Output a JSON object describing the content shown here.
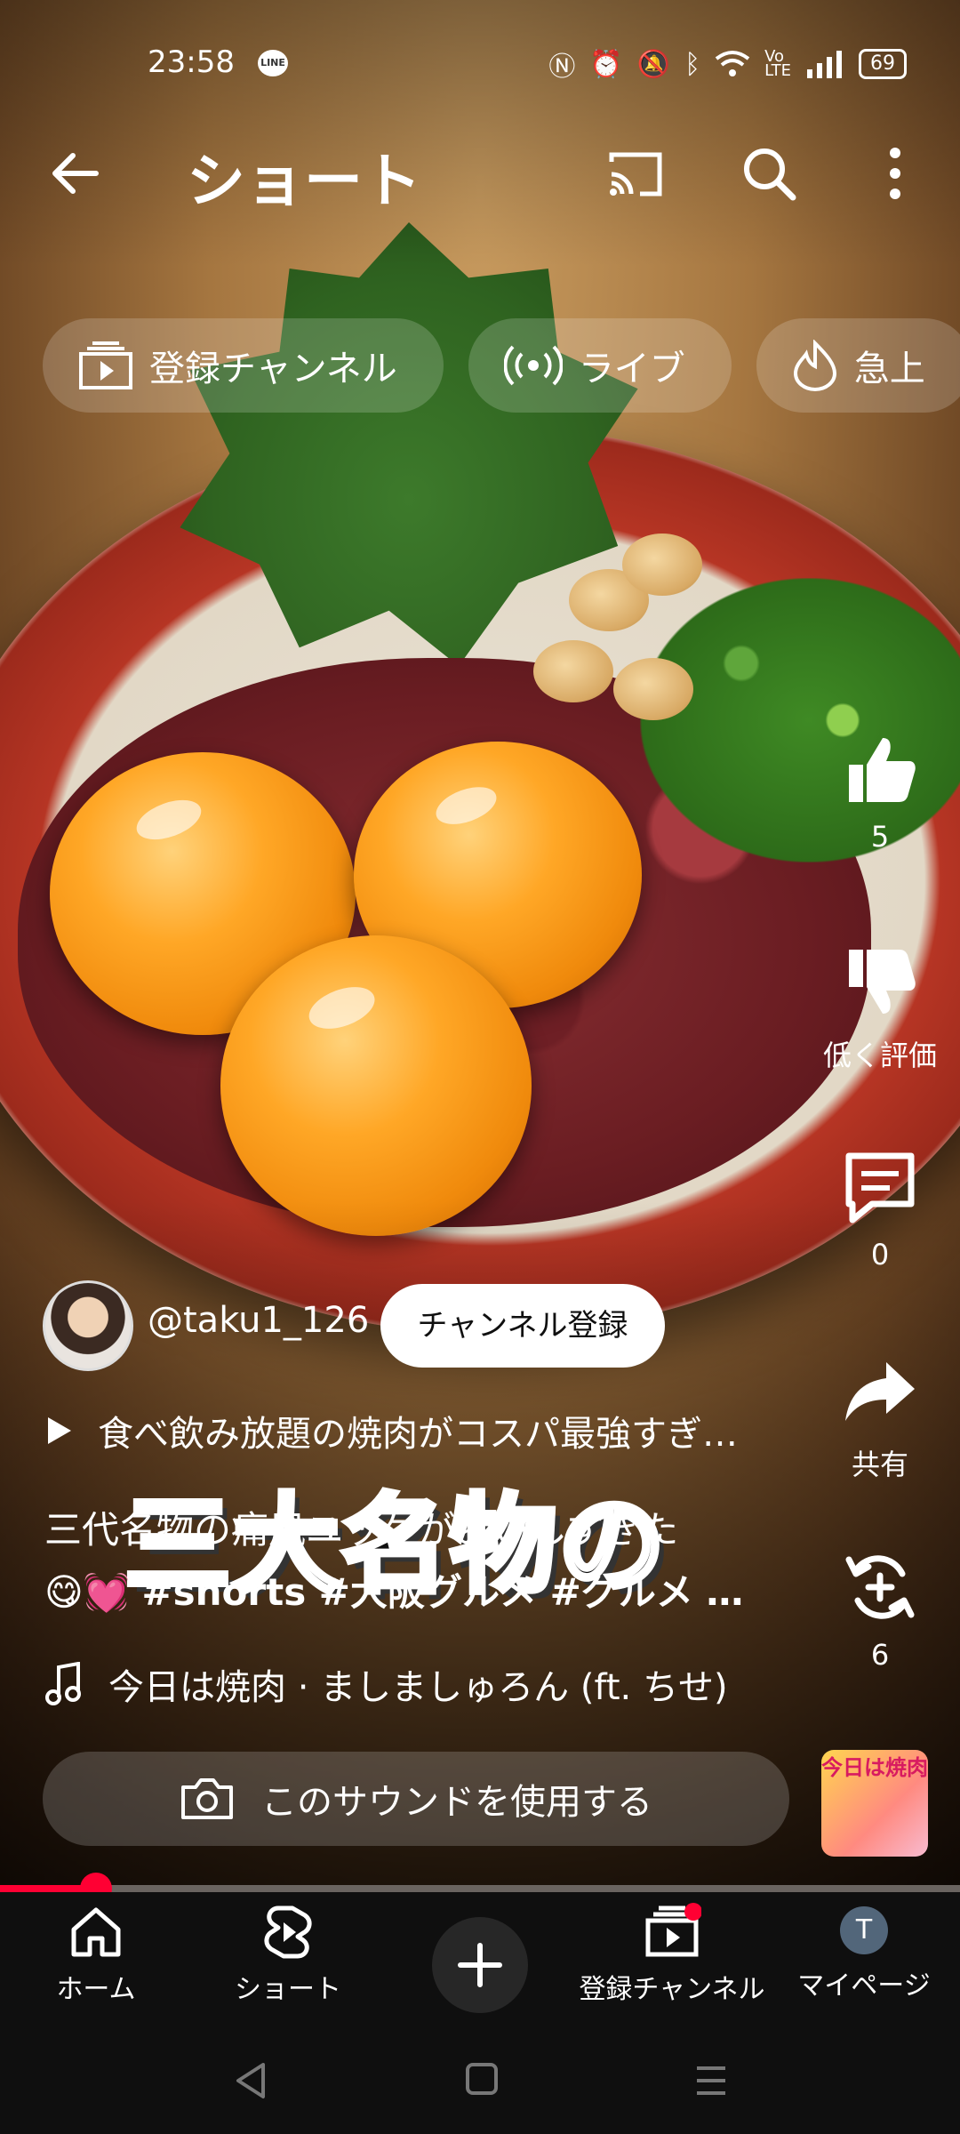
{
  "status_bar": {
    "time": "23:58",
    "line_badge": "LINE",
    "battery": "69"
  },
  "header": {
    "title": "ショート"
  },
  "chips": [
    {
      "label": "登録チャンネル",
      "icon": "subscriptions-icon"
    },
    {
      "label": "ライブ",
      "icon": "live-icon"
    },
    {
      "label": "急上",
      "icon": "trending-icon"
    }
  ],
  "actions": {
    "like_count": "5",
    "dislike_label": "低く評価",
    "comment_count": "0",
    "share_label": "共有",
    "remix_count": "6"
  },
  "channel": {
    "handle": "@taku1_126",
    "subscribe_label": "チャンネル登録"
  },
  "playlist": {
    "title": "食べ飲み放題の焼肉がコスパ最強すぎ…"
  },
  "description": {
    "line1": "三代名物の痛風ユッケがおいしすぎた",
    "emoji": "😋💓",
    "tags": "#shorts #大阪グルメ #グルメ …"
  },
  "video_overlay": {
    "text": "三大名物の"
  },
  "music": {
    "track": "今日は焼肉 · ましましゅろん (ft. ちせ)"
  },
  "use_sound": {
    "label": "このサウンドを使用する"
  },
  "sound_thumb": {
    "text": "今日は焼肉"
  },
  "progress": {
    "fraction": 0.1
  },
  "bottom_nav": {
    "home": "ホーム",
    "shorts": "ショート",
    "subscriptions": "登録チャンネル",
    "mypage": "マイページ",
    "avatar_letter": "T"
  },
  "colors": {
    "accent": "#ff0033",
    "nav_bg": "#0f0f0f"
  }
}
